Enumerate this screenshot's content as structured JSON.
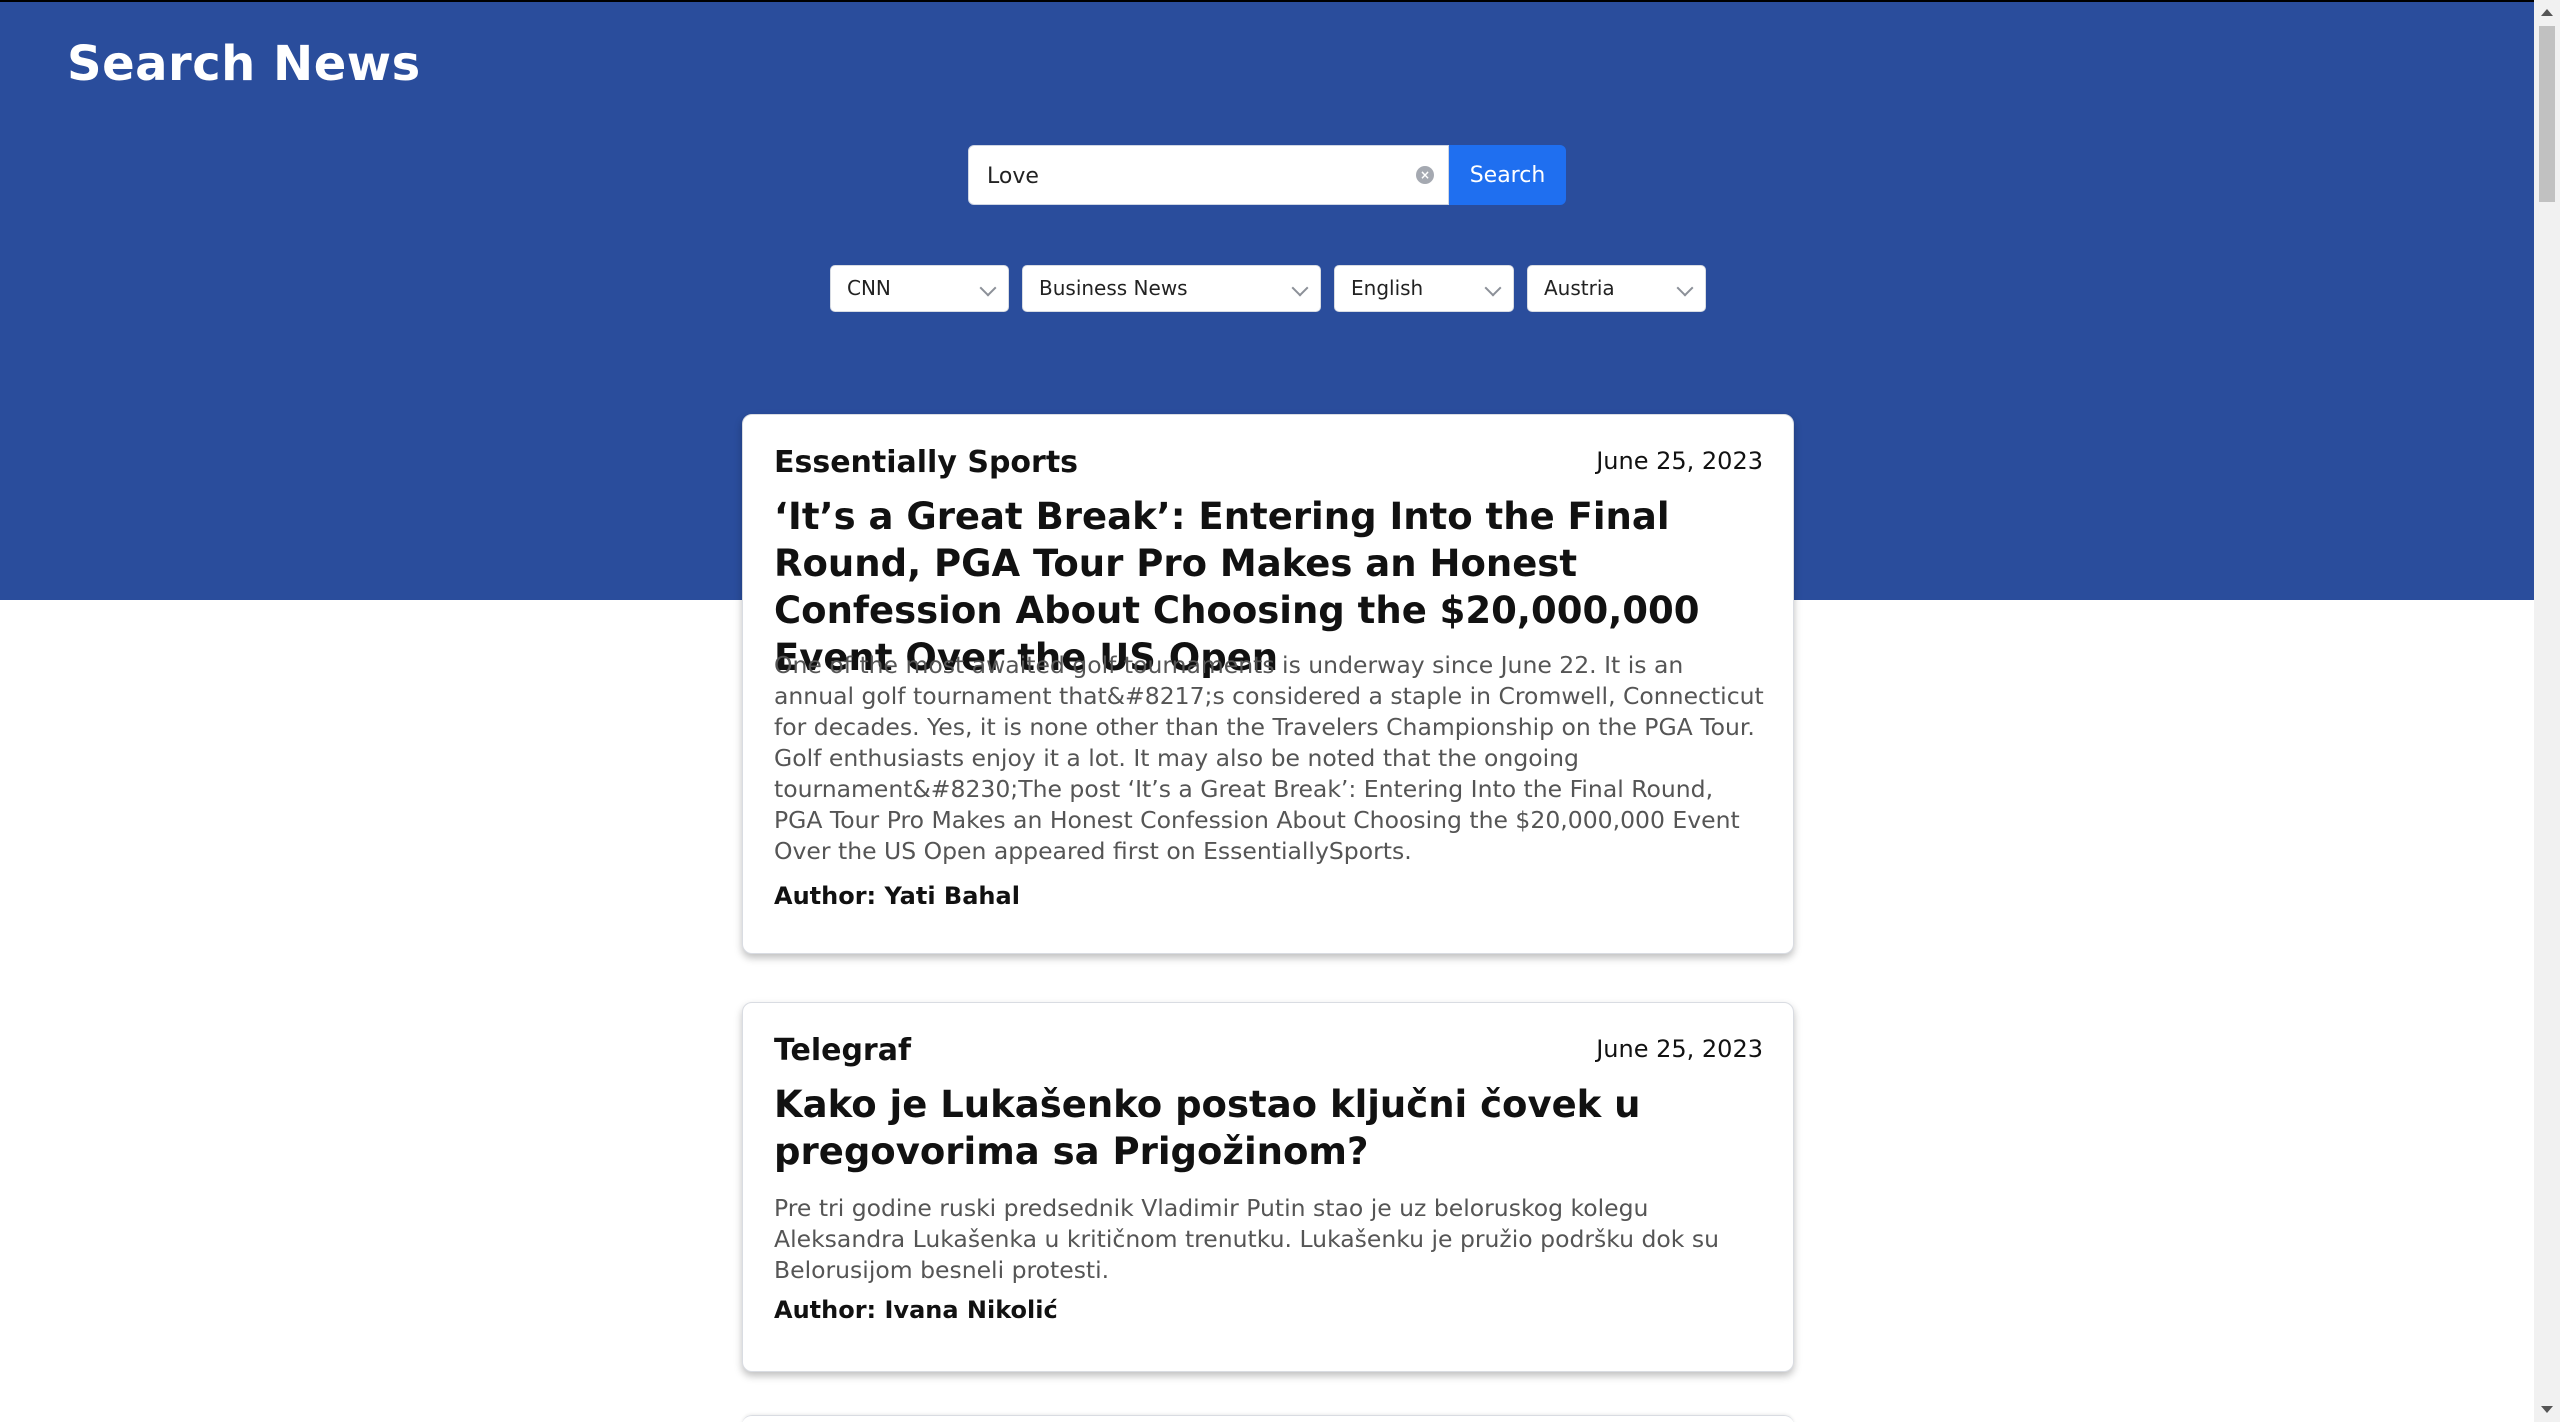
{
  "header": {
    "title": "Search News"
  },
  "search": {
    "value": "Love",
    "button_label": "Search"
  },
  "filters": {
    "source": "CNN",
    "category": "Business News",
    "language": "English",
    "country": "Austria"
  },
  "articles": [
    {
      "source": "Essentially Sports",
      "date": "June 25, 2023",
      "title": "‘It’s a Great Break’: Entering Into the Final Round, PGA Tour Pro Makes an Honest Confession About Choosing the $20,000,000 Event Over the US Open",
      "description": "One of the most awaited golf tournaments is underway since June 22. It is an annual golf tournament that&#8217;s considered a staple in Cromwell, Connecticut for decades. Yes, it is none other than the Travelers Championship on the PGA Tour. Golf enthusiasts enjoy it a lot. It may also be noted that the ongoing tournament&#8230;The post ‘It’s a Great Break’: Entering Into the Final Round, PGA Tour Pro Makes an Honest Confession About Choosing the $20,000,000 Event Over the US Open appeared first on EssentiallySports.",
      "author": "Author: Yati Bahal"
    },
    {
      "source": "Telegraf",
      "date": "June 25, 2023",
      "title": "Kako je Lukašenko postao ključni čovek u pregovorima sa Prigožinom?",
      "description": "Pre tri godine ruski predsednik Vladimir Putin stao je uz beloruskog kolegu Aleksandra Lukašenka u kritičnom trenutku. Lukašenku je pružio podršku dok su Belorusijom besneli protesti.",
      "author": "Author: Ivana Nikolić"
    }
  ]
}
